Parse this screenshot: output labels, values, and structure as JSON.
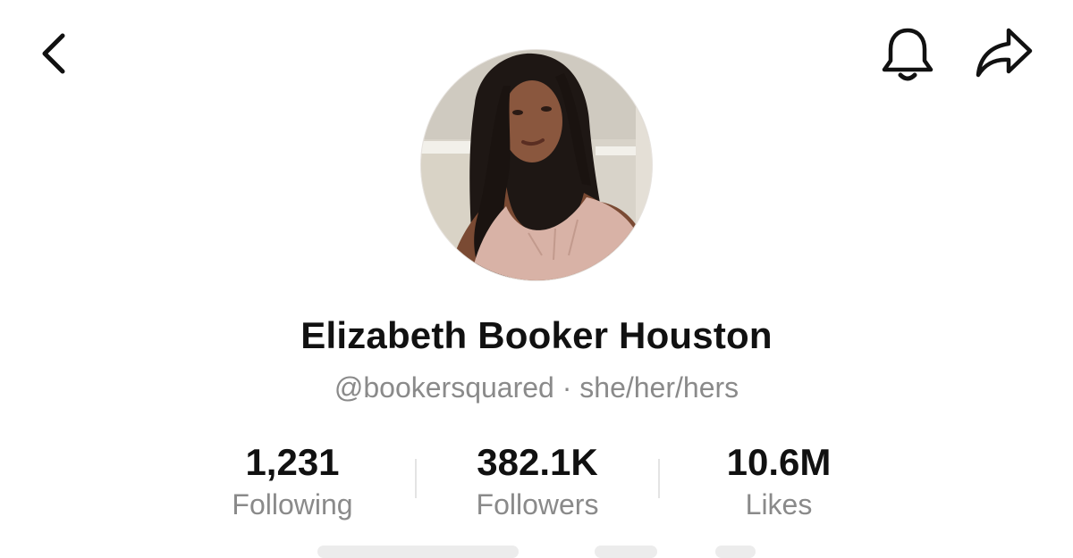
{
  "header": {
    "back_icon": "chevron-left-icon",
    "notification_icon": "bell-icon",
    "share_icon": "share-arrow-icon"
  },
  "profile": {
    "display_name": "Elizabeth Booker Houston",
    "subtitle": "@bookersquared · she/her/hers"
  },
  "stats": [
    {
      "value": "1,231",
      "label": "Following"
    },
    {
      "value": "382.1K",
      "label": "Followers"
    },
    {
      "value": "10.6M",
      "label": "Likes"
    }
  ],
  "colors": {
    "text_primary": "#111111",
    "text_secondary": "#8a8a8a",
    "divider": "#e4e4e4",
    "background": "#ffffff"
  }
}
